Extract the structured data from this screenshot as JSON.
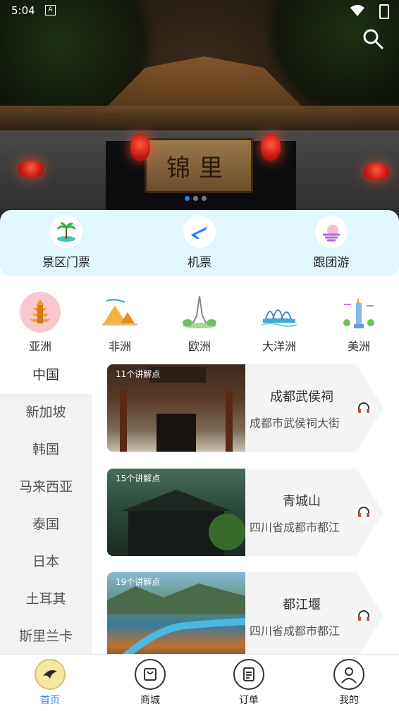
{
  "status_bar": {
    "time": "5:04",
    "notification_letter": "A"
  },
  "banner": {
    "sign_text": "锦里",
    "active_dot": 0,
    "dot_count": 3
  },
  "services": [
    {
      "label": "景区门票",
      "icon": "island-ticket-icon"
    },
    {
      "label": "机票",
      "icon": "airplane-icon"
    },
    {
      "label": "跟团游",
      "icon": "sunset-tour-icon"
    }
  ],
  "continents": [
    {
      "label": "亚洲",
      "icon": "pagoda-icon"
    },
    {
      "label": "非洲",
      "icon": "pyramid-icon"
    },
    {
      "label": "欧洲",
      "icon": "eiffel-tower-icon"
    },
    {
      "label": "大洋洲",
      "icon": "opera-house-icon"
    },
    {
      "label": "美洲",
      "icon": "statue-of-liberty-icon"
    }
  ],
  "countries": [
    "中国",
    "新加坡",
    "韩国",
    "马来西亚",
    "泰国",
    "日本",
    "土耳其",
    "斯里兰卡"
  ],
  "attractions": [
    {
      "count": "11个讲解点",
      "name": "成都武侯祠",
      "address": "成都市武侯祠大街"
    },
    {
      "count": "15个讲解点",
      "name": "青城山",
      "address": "四川省成都市都江"
    },
    {
      "count": "19个讲解点",
      "name": "都江堰",
      "address": "四川省成都市都江"
    }
  ],
  "nav": [
    {
      "label": "首页",
      "icon": "home-bird-icon"
    },
    {
      "label": "商城",
      "icon": "shopping-bag-icon"
    },
    {
      "label": "订单",
      "icon": "order-list-icon"
    },
    {
      "label": "我的",
      "icon": "profile-icon"
    }
  ],
  "colors": {
    "accent": "#2d8cf0",
    "services_bg": "#e2f7fd",
    "sidebar_bg": "#f2f2f2"
  }
}
